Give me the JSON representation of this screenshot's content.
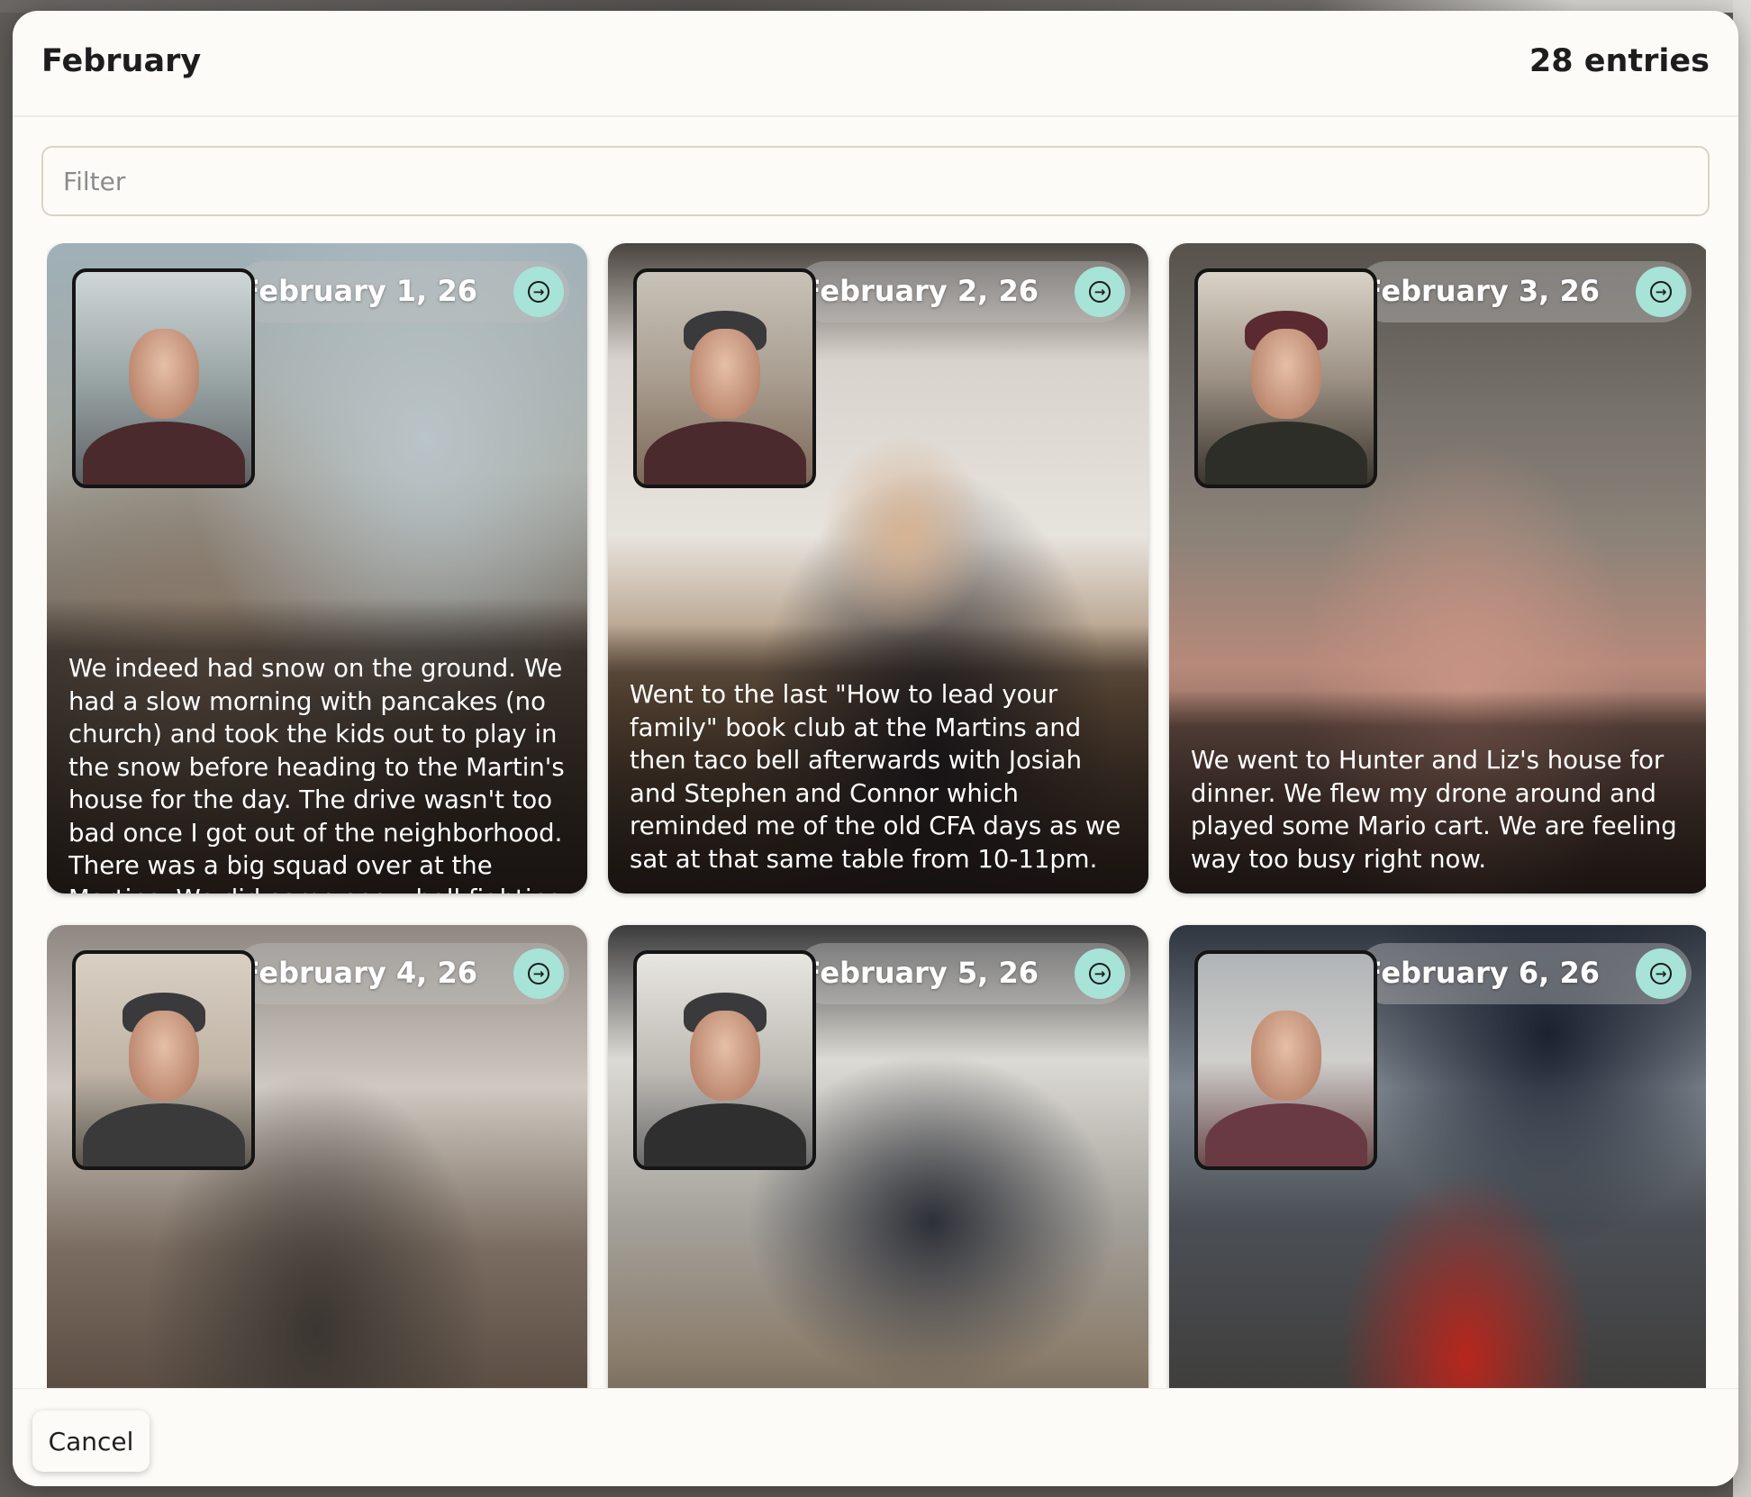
{
  "modal": {
    "title": "February",
    "entry_count": "28 entries"
  },
  "filter": {
    "placeholder": "Filter",
    "value": ""
  },
  "entries": [
    {
      "date": "Sun February 1, 26",
      "text": "We indeed had snow on the ground. We had a slow morning with pancakes (no church) and took the kids out to play in the snow before heading to the Martin's house for the day. The drive wasn't too bad once I got out of the neighborhood. There was a big squad over at the Martins. We did some snow ball fighting and Caleb, Joby and I flew my drone. We had sandwiches for lunch and"
    },
    {
      "date": "Mon February 2, 26",
      "text": "Went to the last \"How to lead your family\" book club at the Martins and then taco bell afterwards with Josiah and Stephen and Connor which reminded me of the old CFA days as we sat at that same table from 10-11pm."
    },
    {
      "date": "Tue February 3, 26",
      "text": "We went to Hunter and Liz's house for dinner. We flew my drone around and played some Mario cart. We are feeling way too busy right now."
    },
    {
      "date": "Wed February 4, 26",
      "text": ""
    },
    {
      "date": "Thu February 5, 26",
      "text": ""
    },
    {
      "date": "Fri February 6, 26",
      "text": ""
    }
  ],
  "footer": {
    "cancel_label": "Cancel"
  },
  "icons": {
    "open_entry": "arrow-right-circle-icon"
  },
  "colors": {
    "accent": "#a7e3d6",
    "modal_bg": "#fcfbf8"
  }
}
